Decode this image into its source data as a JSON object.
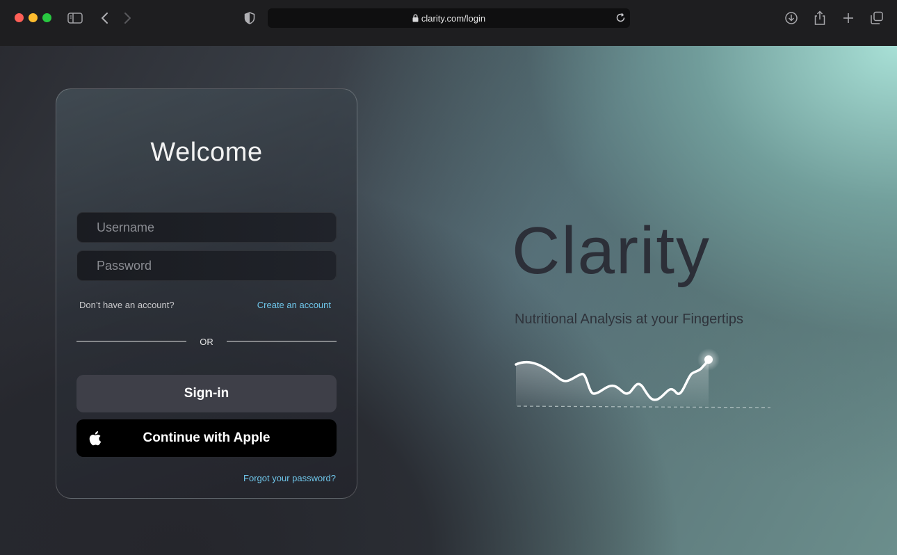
{
  "browser": {
    "url": "clarity.com/login"
  },
  "login": {
    "title": "Welcome",
    "username_placeholder": "Username",
    "password_placeholder": "Password",
    "no_account_text": "Don’t have an account?",
    "create_account_link": "Create an account",
    "divider_text": "OR",
    "signin_label": "Sign-in",
    "apple_label": "Continue with Apple",
    "forgot_link": "Forgot your password?"
  },
  "hero": {
    "brand": "Clarity",
    "tagline": "Nutritional Analysis at your Fingertips"
  },
  "colors": {
    "link": "#6fc6ea",
    "signin_bg": "#3e3f48",
    "apple_bg": "#000000",
    "accent_teal": "#a8e0d6"
  },
  "icons": [
    "sidebar-icon",
    "back-chevron-icon",
    "forward-chevron-icon",
    "shield-icon",
    "lock-icon",
    "reload-icon",
    "download-icon",
    "share-icon",
    "new-tab-icon",
    "tab-overview-icon",
    "apple-icon"
  ]
}
